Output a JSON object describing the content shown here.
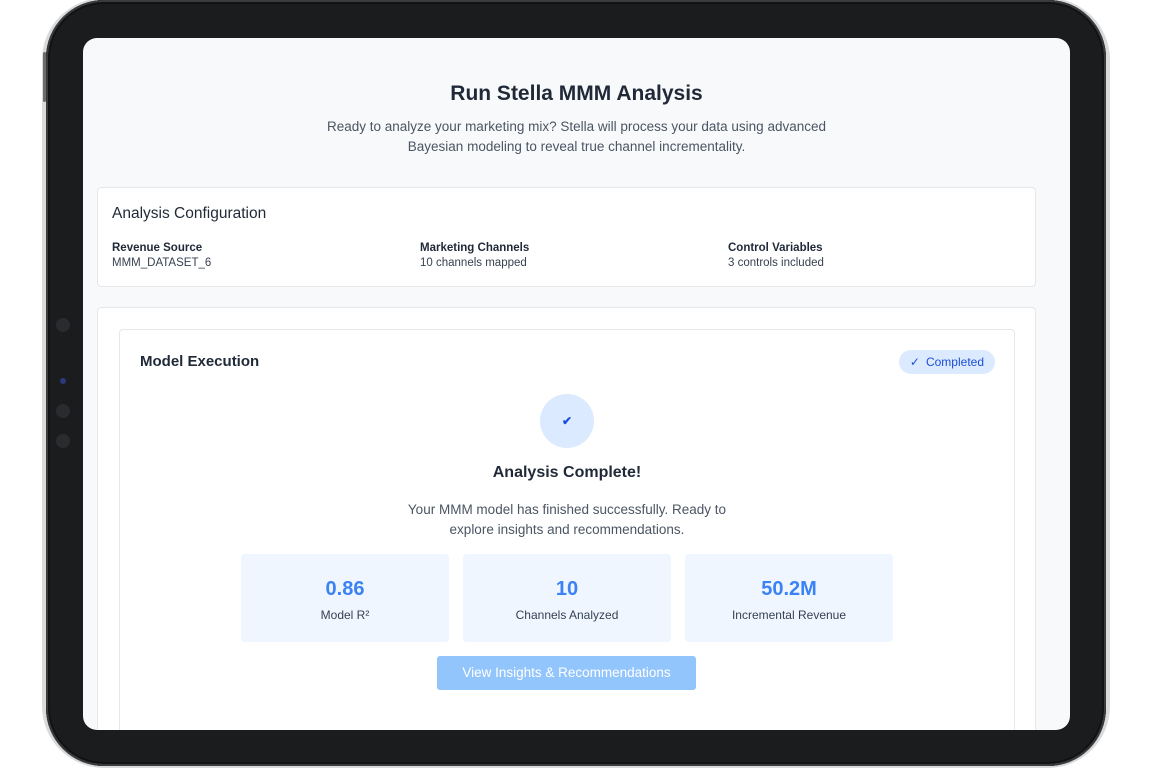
{
  "header": {
    "title": "Run Stella MMM Analysis",
    "subtitle_line1": "Ready to analyze your marketing mix? Stella will process your data using advanced",
    "subtitle_line2": "Bayesian modeling to reveal true channel incrementality."
  },
  "config": {
    "title": "Analysis Configuration",
    "items": [
      {
        "label": "Revenue Source",
        "value": "MMM_DATASET_6"
      },
      {
        "label": "Marketing Channels",
        "value": "10 channels mapped"
      },
      {
        "label": "Control Variables",
        "value": "3 controls included"
      }
    ]
  },
  "execution": {
    "title": "Model Execution",
    "badge_label": "Completed",
    "badge_icon": "check-icon",
    "status_icon": "check-icon",
    "complete_title": "Analysis Complete!",
    "complete_line1": "Your MMM model has finished successfully. Ready to",
    "complete_line2": "explore insights and recommendations.",
    "stats": [
      {
        "value": "0.86",
        "label": "Model R²"
      },
      {
        "value": "10",
        "label": "Channels Analyzed"
      },
      {
        "value": "50.2M",
        "label": "Incremental Revenue"
      }
    ],
    "cta_label": "View Insights & Recommendations"
  },
  "colors": {
    "accent": "#3b82f6",
    "badge_bg": "#dbeafe",
    "stat_bg": "#eff6ff",
    "cta_bg": "#93c5fd"
  }
}
